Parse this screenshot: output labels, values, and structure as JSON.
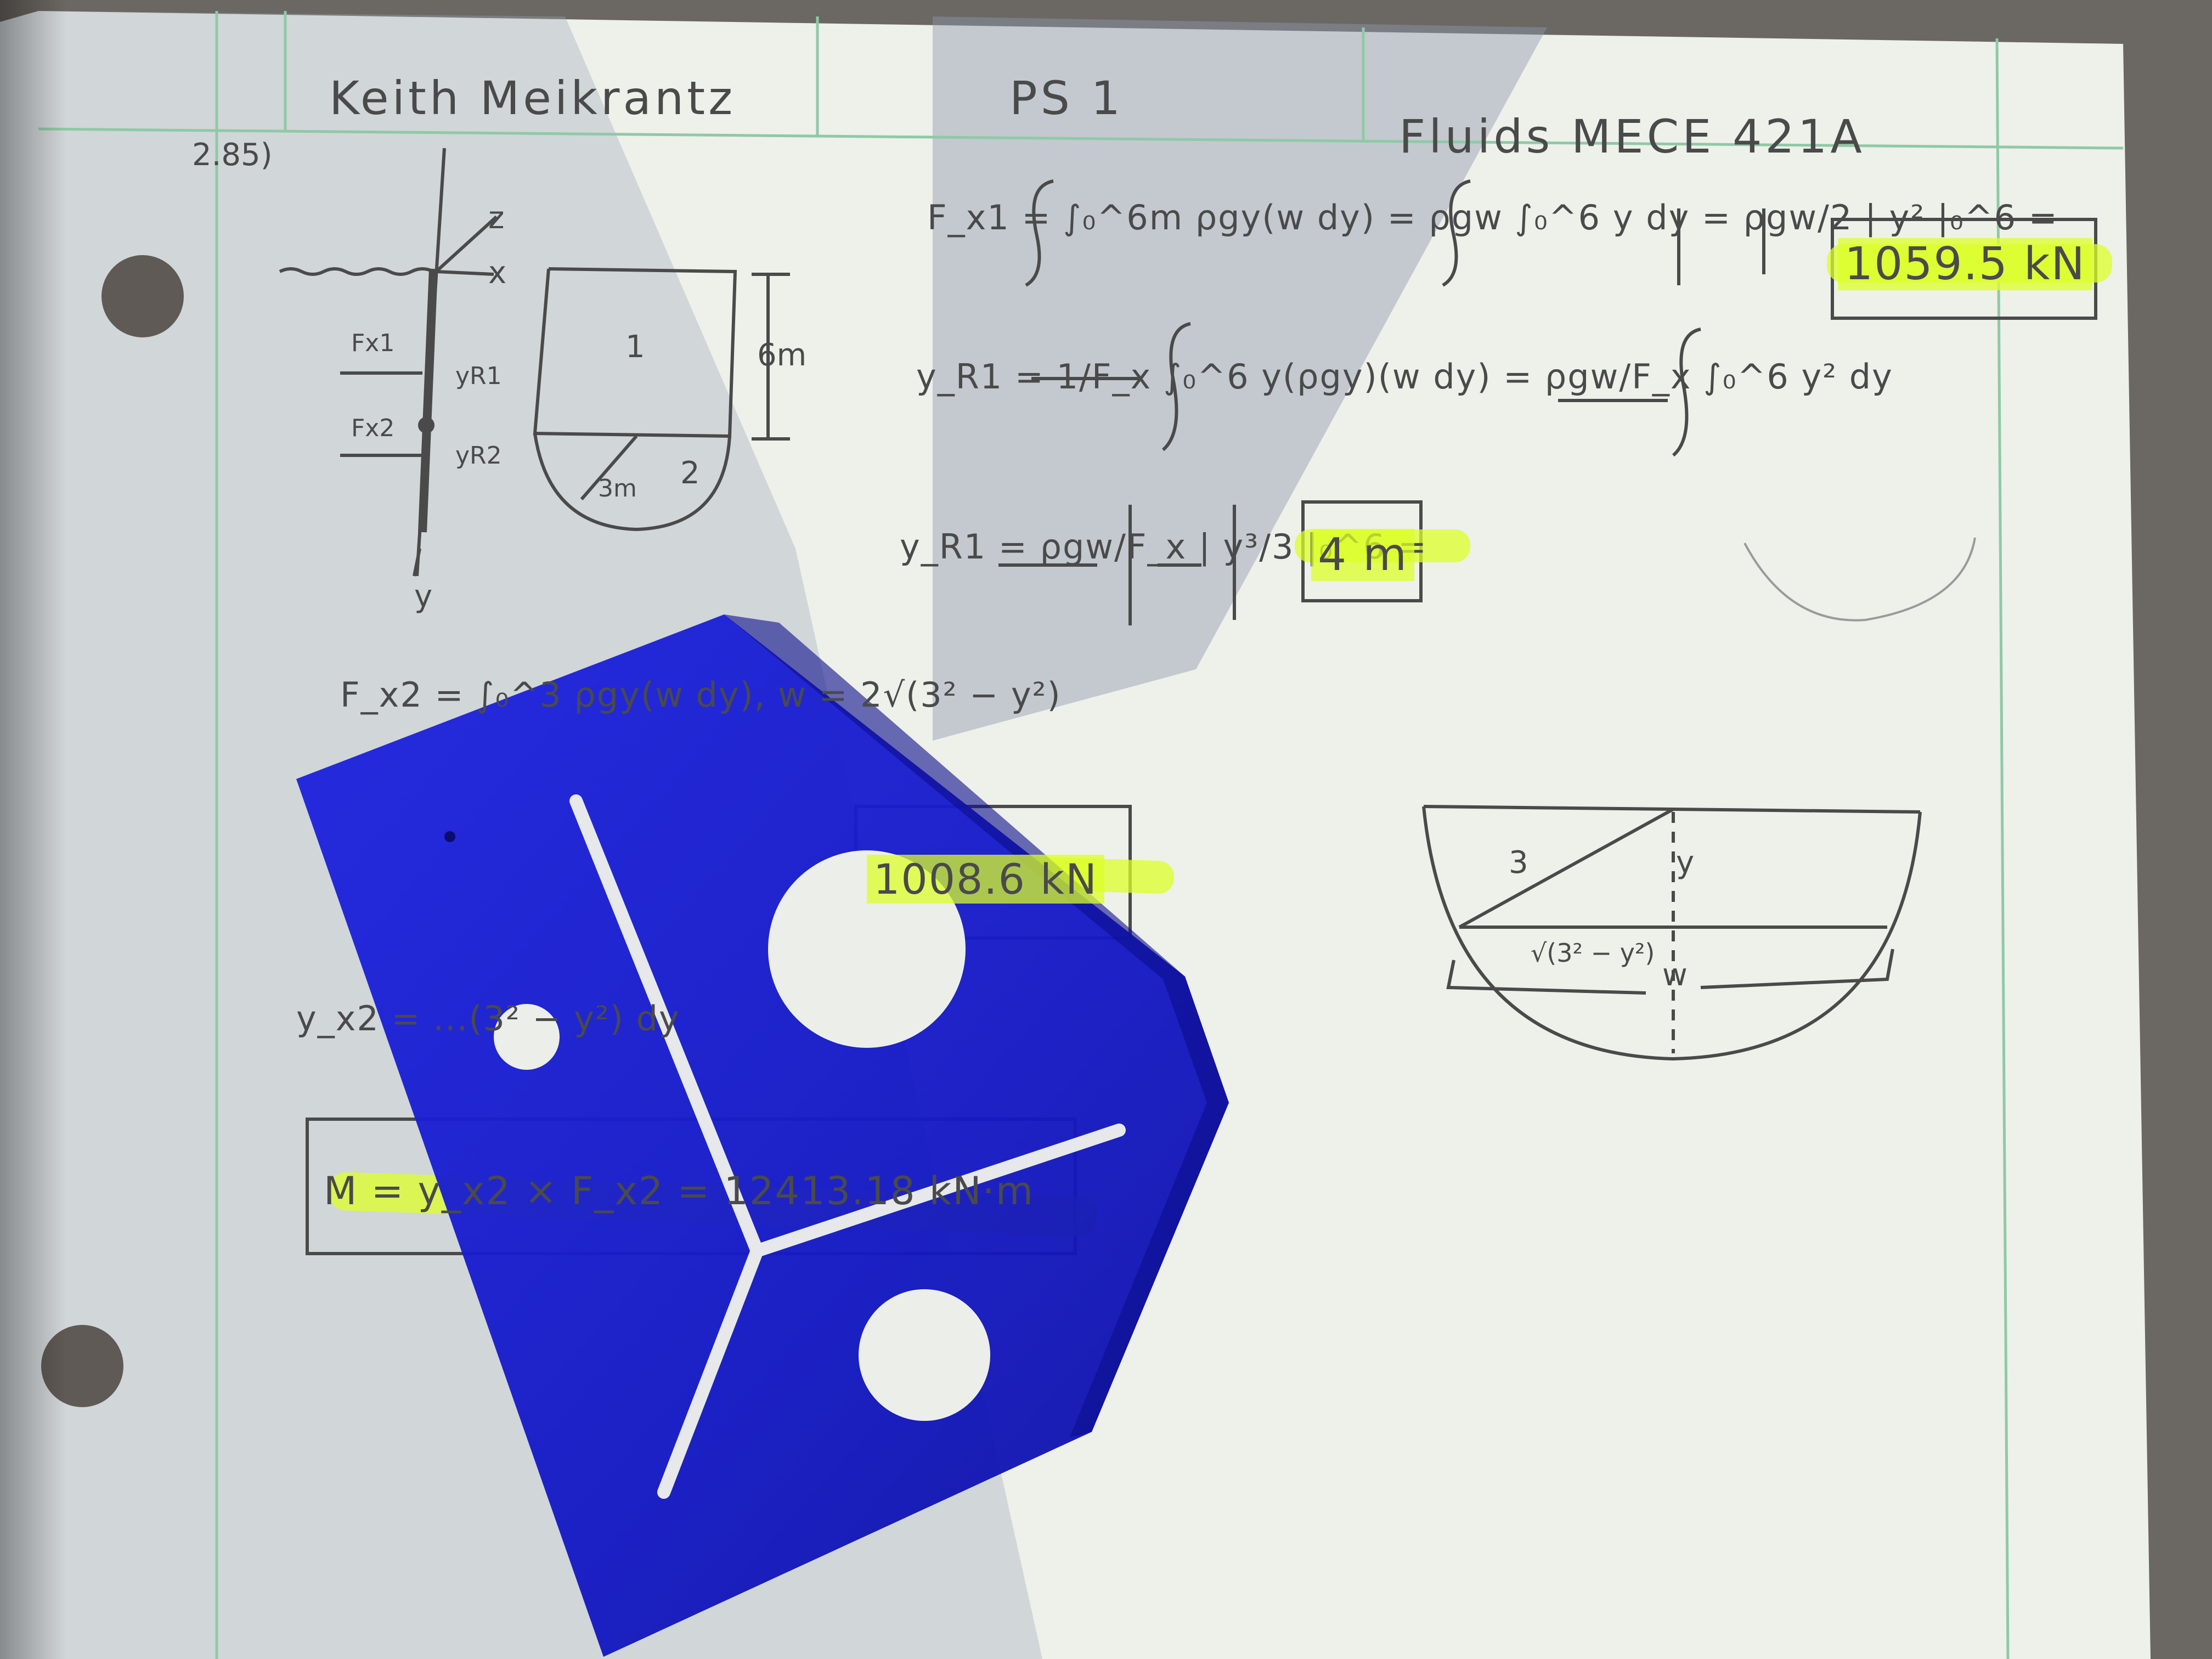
{
  "header": {
    "name": "Keith Meikrantz",
    "assignment": "PS 1",
    "course": "Fluids MECE 421A"
  },
  "problem_number": "2.85)",
  "equations": {
    "fx1": "F_x1 = ∫₀^6m ρgy(w dy) = ρgw ∫₀^6 y dy = ρgw/2 | y² |₀^6 =",
    "fx1_result": "1059.5 kN",
    "yr1": "y_R1 = 1/F_x ∫₀^6 y(ρgy)(w dy) = ρgw/F_x ∫₀^6 y² dy",
    "yr1_b": "y_R1 = ρgw/F_x | y³/3 |₀^6 =",
    "yr1_result": "4 m",
    "fx2": "F_x2 = ∫₀^3 ρgy(w dy), w = 2√(3² − y²)",
    "fx2_result": "1008.6 kN",
    "yx2": "y_x2 = ...(3² − y²) dy",
    "moment": "M = y_x2 × F_x2 = 12413.18 kN·m"
  },
  "diagram_labels": {
    "z": "z",
    "x": "x",
    "y": "y",
    "fx1": "Fx1",
    "fx2": "Fx2",
    "yr1": "yR1",
    "yr2": "yR2",
    "region1": "1",
    "region2": "2",
    "height": "6m",
    "radius": "3m",
    "semi_r": "3",
    "semi_y": "y",
    "semi_w": "w",
    "semi_sqrt": "√(3² − y²)"
  },
  "colors": {
    "paper": "#eef0ea",
    "margin_line": "#8fc9a6",
    "highlight": "#dcff28",
    "acrylic": "#1a1fd0"
  }
}
